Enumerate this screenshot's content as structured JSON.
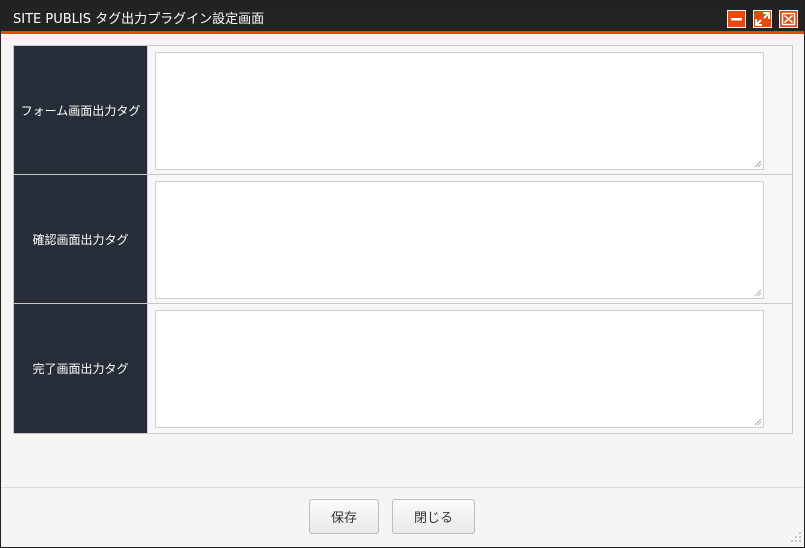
{
  "window": {
    "title": "SITE PUBLIS タグ出力プラグイン設定画面",
    "accent_color": "#e8480b",
    "titlebar_color": "#232323",
    "controls": [
      {
        "name": "minimize",
        "icon": "minimize-icon"
      },
      {
        "name": "maximize",
        "icon": "maximize-icon"
      },
      {
        "name": "close",
        "icon": "close-icon"
      }
    ]
  },
  "form": {
    "rows": [
      {
        "label": "フォーム画面出力タグ",
        "value": ""
      },
      {
        "label": "確認画面出力タグ",
        "value": ""
      },
      {
        "label": "完了画面出力タグ",
        "value": ""
      }
    ]
  },
  "footer": {
    "save_label": "保存",
    "close_label": "閉じる"
  }
}
